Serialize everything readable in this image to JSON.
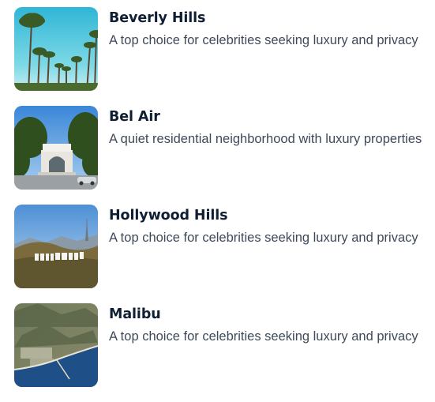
{
  "neighborhoods": [
    {
      "name": "Beverly Hills",
      "description": "A top choice for celebrities seeking luxury and privacy",
      "image": "beverly-hills-palm-trees-photo"
    },
    {
      "name": "Bel Air",
      "description": "A quiet residential neighborhood with luxury properties",
      "image": "bel-air-gate-photo"
    },
    {
      "name": "Hollywood Hills",
      "description": "A top choice for celebrities seeking luxury and privacy",
      "image": "hollywood-sign-photo"
    },
    {
      "name": "Malibu",
      "description": "A top choice for celebrities seeking luxury and privacy",
      "image": "malibu-coastline-photo"
    }
  ],
  "colors": {
    "title": "#0f1f33",
    "description": "#3e4a5a"
  }
}
